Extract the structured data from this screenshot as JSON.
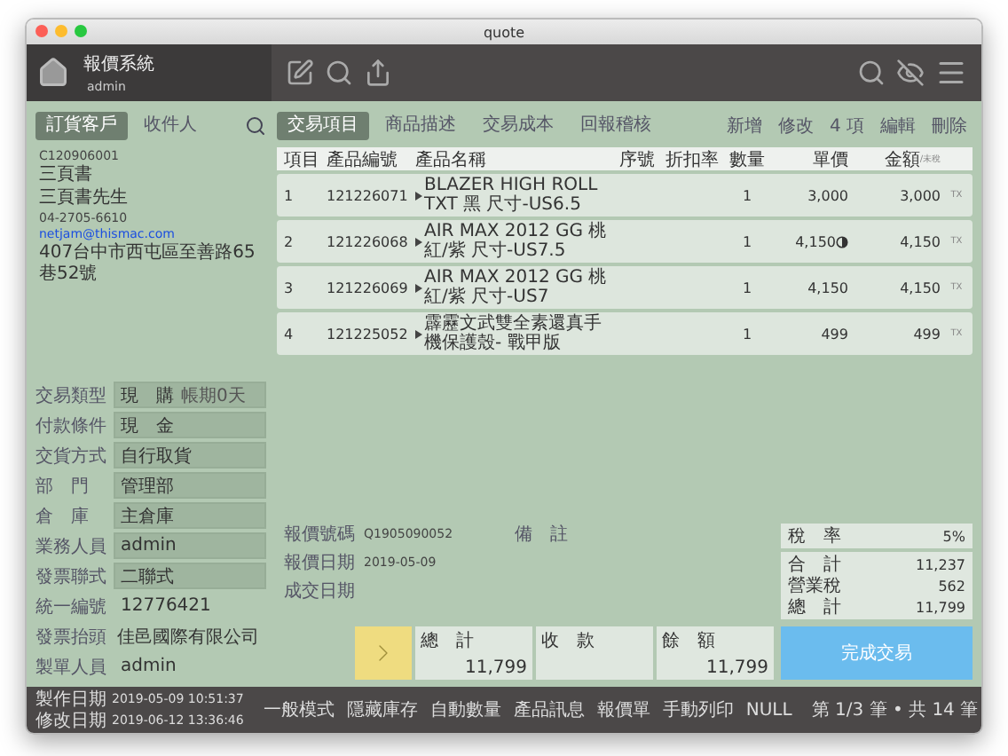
{
  "window": {
    "title": "quote"
  },
  "header": {
    "app_name": "報價系統",
    "user": "admin"
  },
  "customer_tabs": [
    {
      "label": "訂貨客戶",
      "selected": true
    },
    {
      "label": "收件人",
      "selected": false
    }
  ],
  "customer": {
    "code": "C120906001",
    "name": "三頁書",
    "contact": "三頁書先生",
    "phone": "04-2705-6610",
    "email": "netjam@thismac.com",
    "address": "407台中市西屯區至善路65巷52號"
  },
  "detail_tabs": [
    {
      "label": "交易項目",
      "selected": true
    },
    {
      "label": "商品描述",
      "selected": false
    },
    {
      "label": "交易成本",
      "selected": false
    },
    {
      "label": "回報稽核",
      "selected": false
    }
  ],
  "actions": [
    "新增",
    "修改",
    "4 項",
    "編輯",
    "刪除"
  ],
  "table": {
    "columns": [
      "項目",
      "產品編號",
      "產品名稱",
      "序號",
      "折扣率",
      "數量",
      "單價",
      "金額"
    ],
    "amount_note": "/未稅",
    "rows": [
      {
        "item": "1",
        "code": "121226071",
        "name": "BLAZER HIGH ROLL TXT 黑 尺寸-US6.5",
        "qty": "1",
        "price": "3,000",
        "price_flag": false,
        "amount": "3,000",
        "tax": "TX"
      },
      {
        "item": "2",
        "code": "121226068",
        "name": "AIR MAX 2012 GG 桃紅/紫 尺寸-US7.5",
        "qty": "1",
        "price": "4,150",
        "price_flag": true,
        "amount": "4,150",
        "tax": "TX"
      },
      {
        "item": "3",
        "code": "121226069",
        "name": "AIR MAX 2012 GG 桃紅/紫 尺寸-US7",
        "qty": "1",
        "price": "4,150",
        "price_flag": false,
        "amount": "4,150",
        "tax": "TX"
      },
      {
        "item": "4",
        "code": "121225052",
        "name": "霹靂文武雙全素還真手機保護殼- 戰甲版",
        "qty": "1",
        "price": "499",
        "price_flag": false,
        "amount": "499",
        "tax": "TX"
      }
    ]
  },
  "order_fields": [
    {
      "label": "交易類型",
      "value": "現　購",
      "note": "帳期0天",
      "boxed": true
    },
    {
      "label": "付款條件",
      "value": "現　金",
      "boxed": true
    },
    {
      "label": "交貨方式",
      "value": "自行取貨",
      "boxed": true
    },
    {
      "label": "部　門",
      "value": "管理部",
      "boxed": true
    },
    {
      "label": "倉　庫",
      "value": "主倉庫",
      "boxed": true
    },
    {
      "label": "業務人員",
      "value": "admin",
      "boxed": true
    },
    {
      "label": "發票聯式",
      "value": "二聯式",
      "boxed": true
    },
    {
      "label": "統一編號",
      "value": "12776421",
      "boxed": false
    },
    {
      "label": "發票抬頭",
      "value": "佳邑國際有限公司",
      "boxed": false
    },
    {
      "label": "製單人員",
      "value": "admin",
      "boxed": false
    }
  ],
  "quote_info": [
    {
      "label": "報價號碼",
      "value": "Q1905090052"
    },
    {
      "label": "報價日期",
      "value": "2019-05-09"
    },
    {
      "label": "成交日期"
    }
  ],
  "remark_label": "備　註",
  "tax_rate": {
    "label": "稅　率",
    "value": "5%"
  },
  "totals": [
    {
      "label": "合　計",
      "value": "11,237"
    },
    {
      "label": "營業稅",
      "value": "562"
    },
    {
      "label": "總　計",
      "value": "11,799"
    }
  ],
  "payment": [
    {
      "label": "總　計",
      "value": "11,799"
    },
    {
      "label": "收　款"
    },
    {
      "label": "餘　額",
      "value": "11,799"
    }
  ],
  "complete_button": "完成交易",
  "status_bar": {
    "dates": [
      {
        "label": "製作日期",
        "value": "2019-05-09  10:51:37"
      },
      {
        "label": "修改日期",
        "value": "2019-06-12  13:36:46"
      }
    ],
    "modes": [
      "一般模式",
      "隱藏庫存",
      "自動數量",
      "產品訊息",
      "報價單",
      "手動列印",
      "NULL"
    ],
    "record": "第 1/3 筆 • 共 14 筆"
  }
}
